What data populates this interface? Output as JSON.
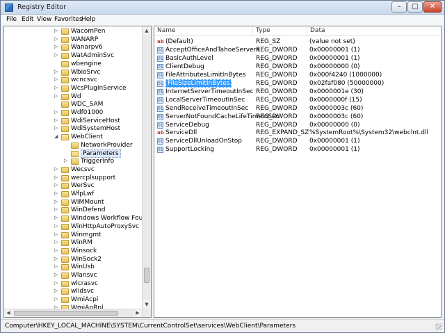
{
  "window": {
    "title": "Registry Editor"
  },
  "menu": [
    "File",
    "Edit",
    "View",
    "Favorites",
    "Help"
  ],
  "tree": [
    {
      "label": "WacomPen",
      "expander": "collapsed"
    },
    {
      "label": "WANARP",
      "expander": "collapsed"
    },
    {
      "label": "Wanarpv6",
      "expander": "collapsed"
    },
    {
      "label": "WatAdminSvc",
      "expander": "collapsed"
    },
    {
      "label": "wbengine",
      "expander": "none"
    },
    {
      "label": "WbioSrvc",
      "expander": "collapsed"
    },
    {
      "label": "wcncsvc",
      "expander": "collapsed"
    },
    {
      "label": "WcsPlugInService",
      "expander": "collapsed"
    },
    {
      "label": "Wd",
      "expander": "collapsed"
    },
    {
      "label": "WDC_SAM",
      "expander": "none"
    },
    {
      "label": "Wdf01000",
      "expander": "collapsed"
    },
    {
      "label": "WdiServiceHost",
      "expander": "collapsed"
    },
    {
      "label": "WdiSystemHost",
      "expander": "collapsed"
    },
    {
      "label": "WebClient",
      "expander": "expanded"
    },
    {
      "label": "NetworkProvider",
      "expander": "none",
      "indent": 1
    },
    {
      "label": "Parameters",
      "expander": "none",
      "indent": 1,
      "selected": true
    },
    {
      "label": "TriggerInfo",
      "expander": "collapsed",
      "indent": 1
    },
    {
      "label": "Wecsvc",
      "expander": "collapsed"
    },
    {
      "label": "wercplsupport",
      "expander": "collapsed"
    },
    {
      "label": "WerSvc",
      "expander": "collapsed"
    },
    {
      "label": "WfpLwf",
      "expander": "collapsed"
    },
    {
      "label": "WIMMount",
      "expander": "collapsed"
    },
    {
      "label": "WinDefend",
      "expander": "collapsed"
    },
    {
      "label": "Windows Workflow Foundation",
      "expander": "collapsed"
    },
    {
      "label": "WinHttpAutoProxySvc",
      "expander": "collapsed"
    },
    {
      "label": "Winmgmt",
      "expander": "collapsed"
    },
    {
      "label": "WinRM",
      "expander": "collapsed"
    },
    {
      "label": "Winsock",
      "expander": "collapsed"
    },
    {
      "label": "WinSock2",
      "expander": "collapsed"
    },
    {
      "label": "WinUsb",
      "expander": "collapsed"
    },
    {
      "label": "Wlansvc",
      "expander": "collapsed"
    },
    {
      "label": "wlcrasvc",
      "expander": "collapsed"
    },
    {
      "label": "wlidsvc",
      "expander": "collapsed"
    },
    {
      "label": "WmiAcpi",
      "expander": "collapsed"
    },
    {
      "label": "WmiApRpl",
      "expander": "collapsed"
    }
  ],
  "columns": {
    "name": "Name",
    "type": "Type",
    "data": "Data"
  },
  "values": [
    {
      "name": "(Default)",
      "type": "REG_SZ",
      "data": "(value not set)",
      "icon": "sz"
    },
    {
      "name": "AcceptOfficeAndTahoeServers",
      "type": "REG_DWORD",
      "data": "0x00000001 (1)",
      "icon": "dw"
    },
    {
      "name": "BasicAuthLevel",
      "type": "REG_DWORD",
      "data": "0x00000001 (1)",
      "icon": "dw"
    },
    {
      "name": "ClientDebug",
      "type": "REG_DWORD",
      "data": "0x00000000 (0)",
      "icon": "dw"
    },
    {
      "name": "FileAttributesLimitInBytes",
      "type": "REG_DWORD",
      "data": "0x000f4240 (1000000)",
      "icon": "dw"
    },
    {
      "name": "FileSizeLimitInBytes",
      "type": "REG_DWORD",
      "data": "0x02faf080 (50000000)",
      "icon": "dw",
      "selected": true
    },
    {
      "name": "InternetServerTimeoutInSec",
      "type": "REG_DWORD",
      "data": "0x0000001e (30)",
      "icon": "dw"
    },
    {
      "name": "LocalServerTimeoutInSec",
      "type": "REG_DWORD",
      "data": "0x0000000f (15)",
      "icon": "dw"
    },
    {
      "name": "SendReceiveTimeoutInSec",
      "type": "REG_DWORD",
      "data": "0x0000003c (60)",
      "icon": "dw"
    },
    {
      "name": "ServerNotFoundCacheLifeTimeInSec",
      "type": "REG_DWORD",
      "data": "0x0000003c (60)",
      "icon": "dw"
    },
    {
      "name": "ServiceDebug",
      "type": "REG_DWORD",
      "data": "0x00000000 (0)",
      "icon": "dw"
    },
    {
      "name": "ServiceDll",
      "type": "REG_EXPAND_SZ",
      "data": "%SystemRoot%\\System32\\webclnt.dll",
      "icon": "sz"
    },
    {
      "name": "ServiceDllUnloadOnStop",
      "type": "REG_DWORD",
      "data": "0x00000001 (1)",
      "icon": "dw"
    },
    {
      "name": "SupportLocking",
      "type": "REG_DWORD",
      "data": "0x00000001 (1)",
      "icon": "dw"
    }
  ],
  "status": "Computer\\HKEY_LOCAL_MACHINE\\SYSTEM\\CurrentControlSet\\services\\WebClient\\Parameters",
  "tree_scroll_position": 0.93
}
